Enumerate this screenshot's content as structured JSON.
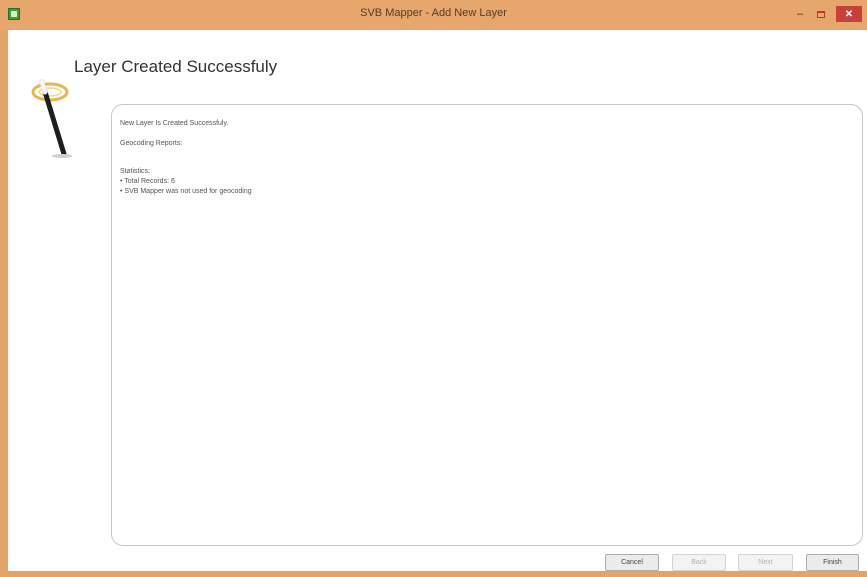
{
  "window": {
    "title": "SVB Mapper - Add New Layer",
    "minimize_icon": "minimize-icon",
    "maximize_icon": "maximize-icon",
    "close_icon": "close-icon",
    "close_glyph": "✕",
    "minimize_glyph": "–"
  },
  "page": {
    "title": "Layer Created Successfuly"
  },
  "report": {
    "line1": "New Layer Is Created Successfuly.",
    "line2": "Geocoding Reports:",
    "line3": "Statistics:",
    "line4": "• Total Records: 6",
    "line5": "• SVB Mapper was not used for geocoding"
  },
  "buttons": {
    "cancel": "Cancel",
    "back": "Back",
    "next": "Next",
    "finish": "Finish"
  },
  "colors": {
    "title_bar": "#e6a66c",
    "close_button": "#c9403a",
    "panel_border": "#c7c7c7"
  }
}
